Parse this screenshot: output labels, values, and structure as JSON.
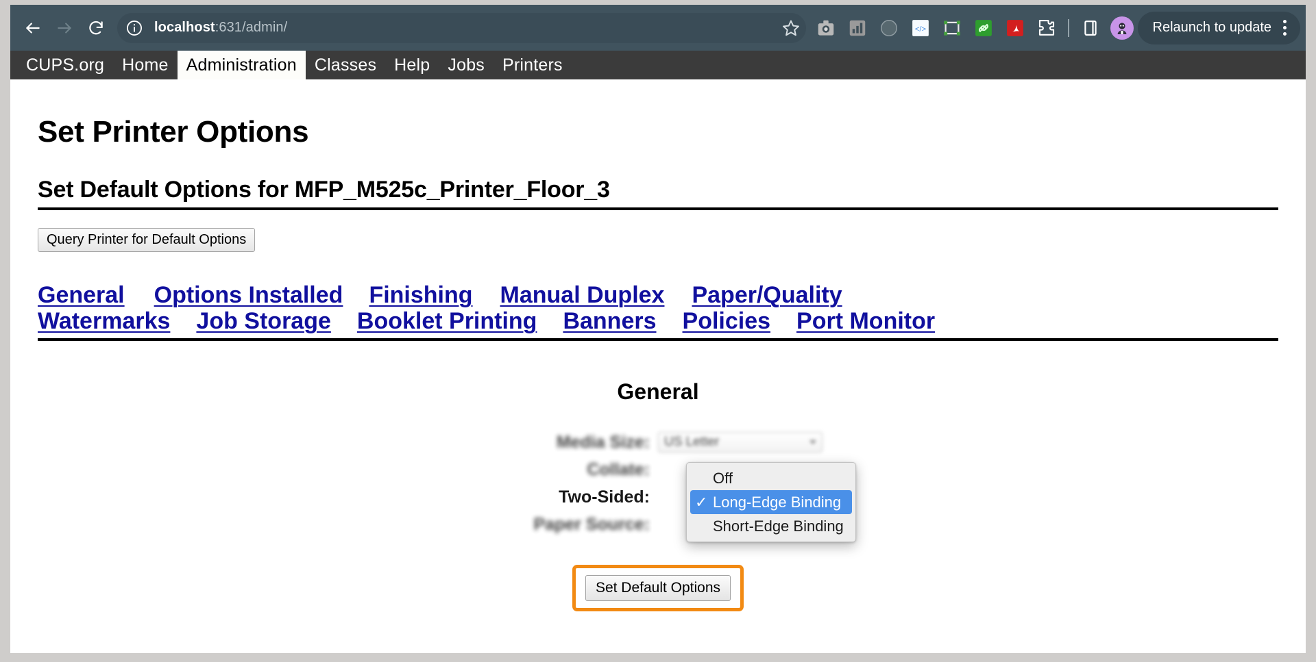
{
  "browser": {
    "back_icon": "back-arrow-icon",
    "forward_icon": "forward-arrow-icon",
    "reload_icon": "reload-icon",
    "site_info_icon": "site-info-icon",
    "url_host": "localhost",
    "url_path": ":631/admin/",
    "bookmark_icon": "star-icon",
    "extensions": [
      {
        "name": "screenshot-extension-icon",
        "color": "#b8b8b8"
      },
      {
        "name": "analytics-extension-icon",
        "color": "#9a9a9a"
      },
      {
        "name": "circle-extension-icon",
        "color": "#5f7078"
      },
      {
        "name": "code-extension-icon",
        "color": "#f7fbff"
      },
      {
        "name": "frame-extension-icon",
        "color": "#3f7a3d"
      },
      {
        "name": "link-extension-icon",
        "color": "#2f9e2f"
      },
      {
        "name": "pdf-extension-icon",
        "color": "#d31f1f"
      },
      {
        "name": "puzzle-extensions-icon",
        "color": "#ffffff"
      },
      {
        "name": "sidepanel-icon",
        "color": "#ffffff"
      }
    ],
    "profile_icon": "profile-avatar-icon",
    "relaunch_label": "Relaunch to update",
    "menu_icon": "kebab-menu-icon"
  },
  "cups_nav": {
    "items": [
      {
        "label": "CUPS.org",
        "active": false
      },
      {
        "label": "Home",
        "active": false
      },
      {
        "label": "Administration",
        "active": true
      },
      {
        "label": "Classes",
        "active": false
      },
      {
        "label": "Help",
        "active": false
      },
      {
        "label": "Jobs",
        "active": false
      },
      {
        "label": "Printers",
        "active": false
      }
    ]
  },
  "page": {
    "title": "Set Printer Options",
    "subtitle": "Set Default Options for MFP_M525c_Printer_Floor_3",
    "query_button": "Query Printer for Default Options",
    "option_links_row1": [
      "General",
      "Options Installed",
      "Finishing",
      "Manual Duplex",
      "Paper/Quality"
    ],
    "option_links_row2": [
      "Watermarks",
      "Job Storage",
      "Booklet Printing",
      "Banners",
      "Policies",
      "Port Monitor"
    ]
  },
  "form": {
    "section_heading": "General",
    "rows": [
      {
        "label": "Media Size:",
        "value": "US Letter",
        "control": "select"
      },
      {
        "label": "Collate:",
        "value": "",
        "control": "select"
      },
      {
        "label": "Two-Sided:",
        "value": "",
        "control": "select"
      },
      {
        "label": "Paper Source:",
        "value": "",
        "control": "select"
      }
    ],
    "submit_label": "Set Default Options",
    "highlight_color": "#f28a13"
  },
  "dropdown": {
    "open": true,
    "field": "Two-Sided",
    "selected": "Long-Edge Binding",
    "check_glyph": "✓",
    "highlight_color": "#4a90e8",
    "items": [
      {
        "label": "Off",
        "selected": false
      },
      {
        "label": "Long-Edge Binding",
        "selected": true
      },
      {
        "label": "Short-Edge Binding",
        "selected": false
      }
    ]
  }
}
